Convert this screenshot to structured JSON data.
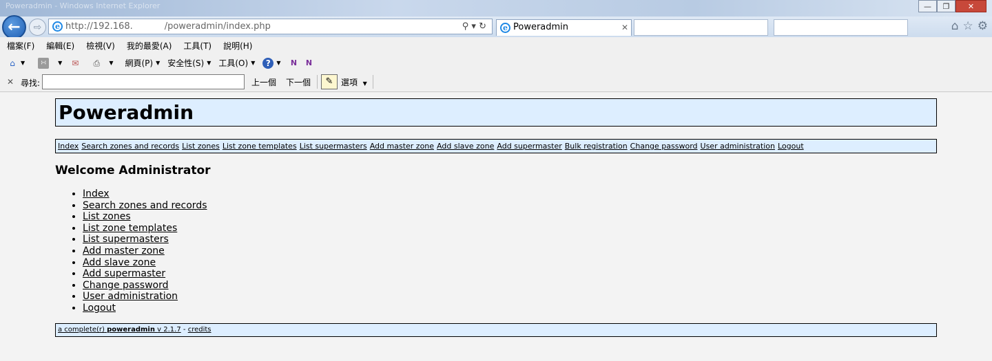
{
  "browser": {
    "window_title": "Poweradmin - Windows Internet Explorer",
    "address": {
      "host": "http://192.168.",
      "path": "/poweradmin/index.php"
    },
    "tab_title": "Poweradmin",
    "menu": [
      "檔案(F)",
      "編輯(E)",
      "檢視(V)",
      "我的最愛(A)",
      "工具(T)",
      "說明(H)"
    ],
    "commands": {
      "page": "網頁(P)",
      "safety": "安全性(S)",
      "tools": "工具(O)"
    },
    "find": {
      "label": "尋找:",
      "value": "",
      "prev": "上一個",
      "next": "下一個",
      "options": "選項"
    },
    "icons": [
      "back-icon",
      "forward-icon",
      "ie-logo-icon",
      "search-icon",
      "refresh-icon",
      "home-icon",
      "favorites-star-icon",
      "gear-icon",
      "feeds-icon",
      "mail-icon",
      "print-icon",
      "help-icon",
      "onenote-icon",
      "highlight-icon"
    ]
  },
  "page": {
    "title": "Poweradmin",
    "nav": [
      "Index",
      "Search zones and records",
      "List zones",
      "List zone templates",
      "List supermasters",
      "Add master zone",
      "Add slave zone",
      "Add supermaster",
      "Bulk registration",
      "Change password",
      "User administration",
      "Logout"
    ],
    "welcome": "Welcome Administrator",
    "menu": [
      "Index",
      "Search zones and records",
      "List zones",
      "List zone templates",
      "List supermasters",
      "Add master zone",
      "Add slave zone",
      "Add supermaster",
      "Change password",
      "User administration",
      "Logout"
    ],
    "footer": {
      "prefix": "a complete(r)",
      "brand": "poweradmin",
      "version": "v 2.1.7",
      "separator": "-",
      "credits": "credits"
    }
  },
  "colors": {
    "header_bg": "#ddeeff",
    "page_bg": "#f3f3f3",
    "chrome_bg": "#f0f0f0"
  }
}
